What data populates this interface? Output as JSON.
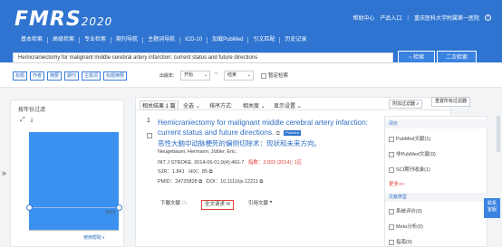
{
  "header": {
    "logo_main": "FMRS",
    "logo_year": "2020",
    "links": [
      "帮助中心",
      "产品入口",
      "重庆医科大学附属第一医院"
    ]
  },
  "nav": [
    "基本检索",
    "高级检索",
    "专业检索",
    "期刊导航",
    "主题词导航",
    "ICD-10",
    "加载PubMed",
    "引文匹配",
    "历史记录"
  ],
  "search": {
    "value": "Hemicraniectomy for malignant middle cerebral artery infarction: current status and future directions",
    "search_label": "检索",
    "second_label": "二次检索"
  },
  "filters": {
    "tags": [
      "标题",
      "作者",
      "摘要",
      "期刊",
      "主题词",
      "标题摘要"
    ],
    "year_label": "出版年:",
    "start": "开始",
    "dash": "~",
    "end": "结束",
    "review_label": "暂定检索"
  },
  "left_panel": {
    "title": "按年份过滤",
    "icons": [
      "expand-icon",
      "download-icon"
    ],
    "year": "2014",
    "help": "使用帮助"
  },
  "chart_data": {
    "type": "bar",
    "categories": [
      "2014"
    ],
    "values": [
      1
    ]
  },
  "toolbar": {
    "result_count": "相关结果 1 篇",
    "select_all": "全选",
    "sort_label": "排序方式:",
    "sort_value": "相关度",
    "display": "显示设置",
    "attach_filter": "附加过滤器",
    "reset_filter": "重置所有过滤器"
  },
  "article": {
    "num": "1",
    "title": "Hemicraniectomy for malignant middle cerebral artery infarction: current status and future directions.",
    "badge": "PubMed",
    "title_zh": "恶性大脑中动脉梗死的偏侧切除术：现状和未来方向。",
    "authors": "Neugebauer, Hermann; Jüttler, Eric.",
    "journal": "INT J STROKE. 2014-06-01;9(4):460-7",
    "impact": "指数：3.833 (2014); 1区",
    "sjr": "SJR：1.841",
    "hix": "HIX：85",
    "pmid": "PMID：24725828",
    "doi": "DOI：10.1111/ijs.12211",
    "download": "下载文献",
    "fulltext": "全文请求",
    "cite": "引用文献"
  },
  "right_panel": {
    "section1": "评价",
    "items1": [
      "PubMed文献(1)",
      "非PubMed文献(0)",
      "SCI期刊收录(1)"
    ],
    "more": "更多>>",
    "section2": "文献类型",
    "items2": [
      "系统评价(0)",
      "Meta分析(0)",
      "指南(0)"
    ]
  },
  "float": "联系\n客服",
  "colors": {
    "primary": "#2f74d0",
    "accent_red": "#e0403a",
    "bar": "#3a91f0"
  }
}
